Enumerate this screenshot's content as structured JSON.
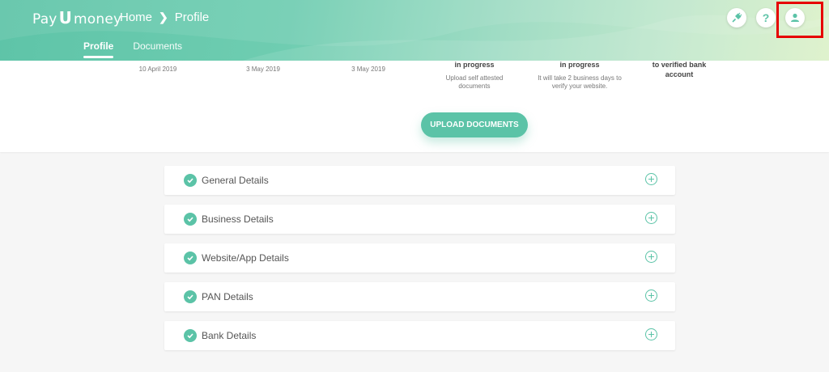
{
  "brand": {
    "pay": "Pay",
    "u": "U",
    "money": "money"
  },
  "breadcrumb": {
    "home": "Home",
    "current": "Profile"
  },
  "tabs": [
    {
      "label": "Profile",
      "active": true
    },
    {
      "label": "Documents",
      "active": false
    }
  ],
  "header_icons": [
    "plug-icon",
    "help-icon",
    "user-icon"
  ],
  "help_glyph": "?",
  "status": {
    "dates": [
      "10 April 2019",
      "3 May 2019",
      "3 May 2019"
    ],
    "steps": [
      {
        "title": "in progress",
        "sub1": "Upload self attested",
        "sub2": "documents"
      },
      {
        "title": "in progress",
        "sub1": "It will take 2 business days to",
        "sub2": "verify your website."
      },
      {
        "title1": "to verified bank",
        "title2": "account"
      }
    ]
  },
  "upload_button": "UPLOAD DOCUMENTS",
  "sections": [
    {
      "label": "General Details"
    },
    {
      "label": "Business Details"
    },
    {
      "label": "Website/App Details"
    },
    {
      "label": "PAN Details"
    },
    {
      "label": "Bank Details"
    }
  ],
  "colors": {
    "accent": "#5bc3a7",
    "highlight": "#e60000"
  }
}
